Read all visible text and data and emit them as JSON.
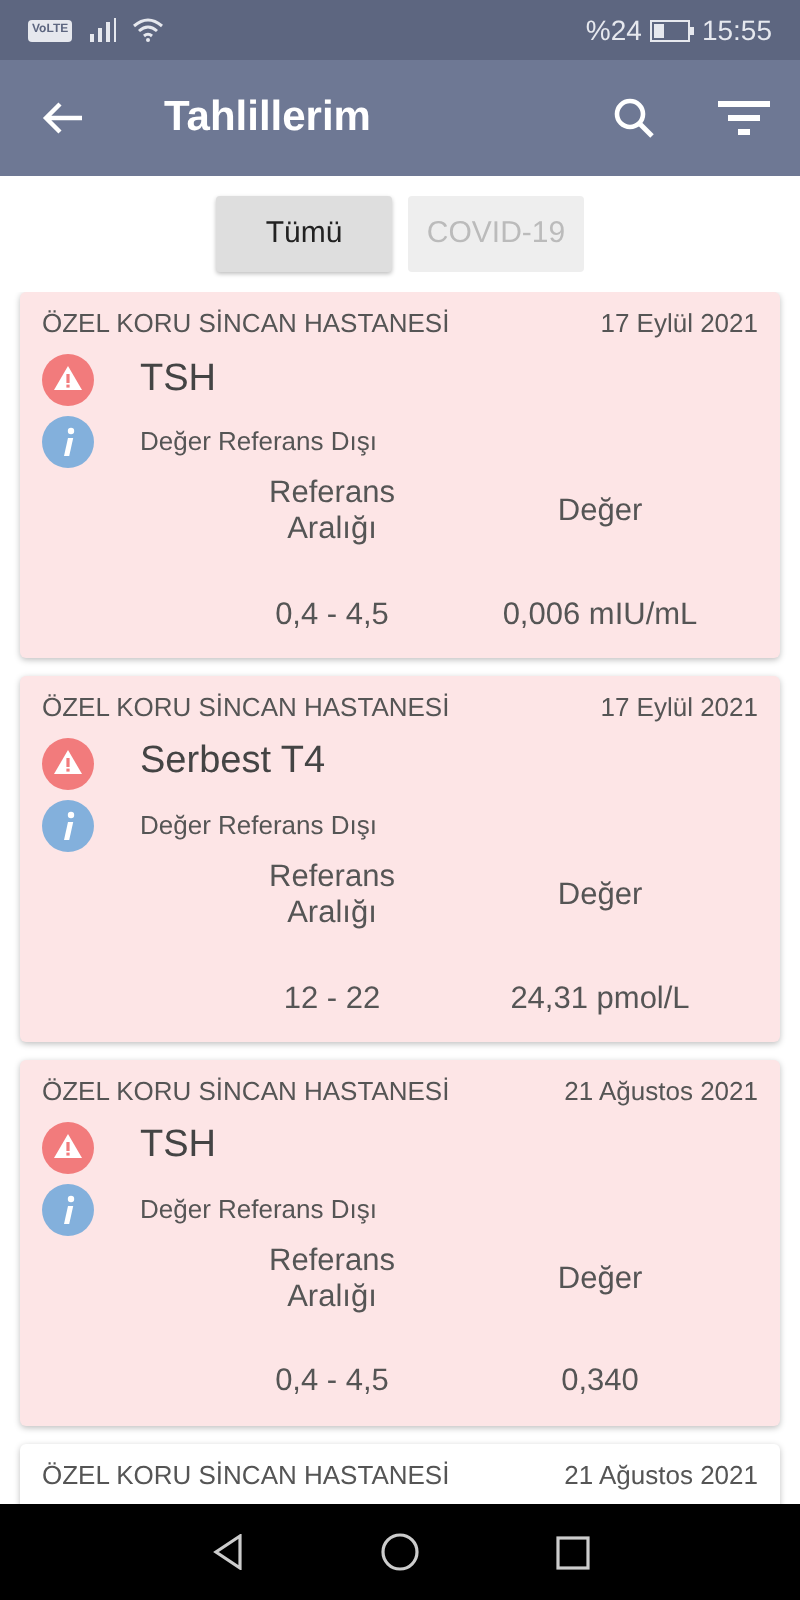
{
  "status_bar": {
    "network": "VoLTE",
    "battery_text": "%24",
    "time": "15:55"
  },
  "app_bar": {
    "title": "Tahlillerim"
  },
  "filters": [
    {
      "label": "Tümü",
      "selected": true
    },
    {
      "label": "COVID-19",
      "selected": false
    }
  ],
  "results": [
    {
      "hospital": "ÖZEL KORU SİNCAN HASTANESİ",
      "date": "17 Eylül 2021",
      "kind": "abnormal",
      "test": "TSH",
      "note": "Değer Referans Dışı",
      "range_label": "Referans Aralığı",
      "value_label": "Değer",
      "range": "0,4 - 4,5",
      "value": "0,006 mIU/mL"
    },
    {
      "hospital": "ÖZEL KORU SİNCAN HASTANESİ",
      "date": "17 Eylül 2021",
      "kind": "abnormal",
      "test": "Serbest T4",
      "note": "Değer Referans Dışı",
      "range_label": "Referans Aralığı",
      "value_label": "Değer",
      "range": "12 - 22",
      "value": "24,31 pmol/L"
    },
    {
      "hospital": "ÖZEL KORU SİNCAN HASTANESİ",
      "date": "21 Ağustos 2021",
      "kind": "abnormal",
      "test": "TSH",
      "note": "Değer Referans Dışı",
      "range_label": "Referans Aralığı",
      "value_label": "Değer",
      "range": "0,4 - 4,5",
      "value": "0,340"
    },
    {
      "hospital": "ÖZEL KORU SİNCAN HASTANESİ",
      "date": "21 Ağustos 2021",
      "kind": "normal"
    }
  ]
}
